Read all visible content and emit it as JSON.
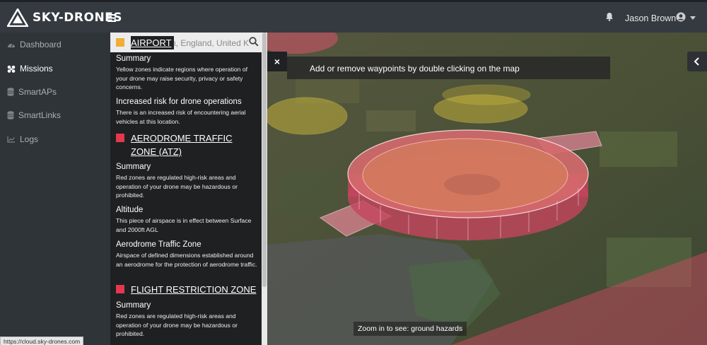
{
  "app": {
    "brand": "SKY-DRONES",
    "status_url": "https://cloud.sky-drones.com"
  },
  "topbar": {
    "user_name": "Jason Brown",
    "icons": [
      "menu-icon",
      "bell-icon",
      "user-circle-icon",
      "caret-down-icon"
    ]
  },
  "sidebar": {
    "items": [
      {
        "label": "Dashboard",
        "icon": "dashboard-icon"
      },
      {
        "label": "Missions",
        "icon": "missions-icon",
        "active": true
      },
      {
        "label": "SmartAPs",
        "icon": "database-icon"
      },
      {
        "label": "SmartLinks",
        "icon": "database-icon"
      },
      {
        "label": "Logs",
        "icon": "chart-icon"
      }
    ]
  },
  "panel": {
    "search_value": "n, England, United Ki",
    "sections": [
      {
        "title": "AIRPORT",
        "color": "#f0ad3a",
        "blocks": [
          {
            "heading": "Summary",
            "text": "Yellow zones indicate regions where operation of your drone may raise security, privacy or safety concerns."
          },
          {
            "heading": "Increased risk for drone operations",
            "text": "There is an increased risk of encountering aerial vehicles at this location."
          }
        ]
      },
      {
        "title": "AERODROME TRAFFIC ZONE (ATZ)",
        "color": "#e5374f",
        "blocks": [
          {
            "heading": "Summary",
            "text": "Red zones are regulated high-risk areas and operation of your drone may be hazardous or prohibited."
          },
          {
            "heading": "Altitude",
            "text": "This piece of airspace is in effect between Surface and 2000ft AGL"
          },
          {
            "heading": "Aerodrome Traffic Zone",
            "text": "Airspace of defined dimensions established around an aerodrome for the protection of aerodrome traffic."
          }
        ]
      },
      {
        "title": "FLIGHT RESTRICTION ZONE",
        "color": "#e5374f",
        "blocks": [
          {
            "heading": "Summary",
            "text": "Red zones are regulated high-risk areas and operation of your drone may be hazardous or prohibited."
          }
        ]
      }
    ]
  },
  "map": {
    "hint": "Add or remove waypoints by double clicking on the map",
    "close_label": "×",
    "zoom_note": "Zoom in to see: ground hazards"
  }
}
